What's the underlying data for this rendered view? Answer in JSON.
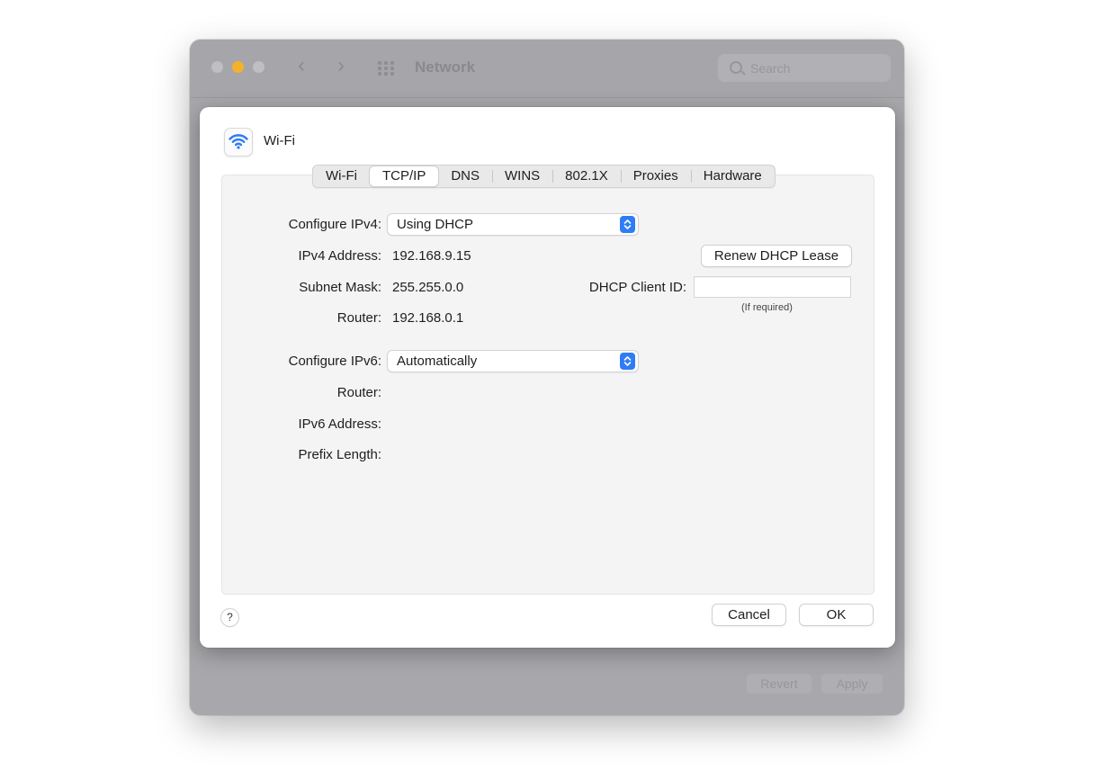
{
  "window": {
    "title": "Network",
    "search_placeholder": "Search",
    "revert_label": "Revert",
    "apply_label": "Apply",
    "traffic_light_accent": "#f5b229"
  },
  "sheet": {
    "interface_icon": "wifi-icon",
    "interface_name": "Wi-Fi",
    "tabs": [
      {
        "label": "Wi-Fi",
        "active": false
      },
      {
        "label": "TCP/IP",
        "active": true
      },
      {
        "label": "DNS",
        "active": false
      },
      {
        "label": "WINS",
        "active": false
      },
      {
        "label": "802.1X",
        "active": false
      },
      {
        "label": "Proxies",
        "active": false
      },
      {
        "label": "Hardware",
        "active": false
      }
    ],
    "ipv4": {
      "configure_label": "Configure IPv4:",
      "configure_value": "Using DHCP",
      "address_label": "IPv4 Address:",
      "address_value": "192.168.9.15",
      "subnet_label": "Subnet Mask:",
      "subnet_value": "255.255.0.0",
      "router_label": "Router:",
      "router_value": "192.168.0.1",
      "renew_button": "Renew DHCP Lease",
      "client_id_label": "DHCP Client ID:",
      "client_id_value": "",
      "client_id_hint": "(If required)"
    },
    "ipv6": {
      "configure_label": "Configure IPv6:",
      "configure_value": "Automatically",
      "router_label": "Router:",
      "address_label": "IPv6 Address:",
      "prefix_label": "Prefix Length:"
    },
    "help_label": "?",
    "cancel_label": "Cancel",
    "ok_label": "OK",
    "accent_color": "#2e7cf6"
  }
}
